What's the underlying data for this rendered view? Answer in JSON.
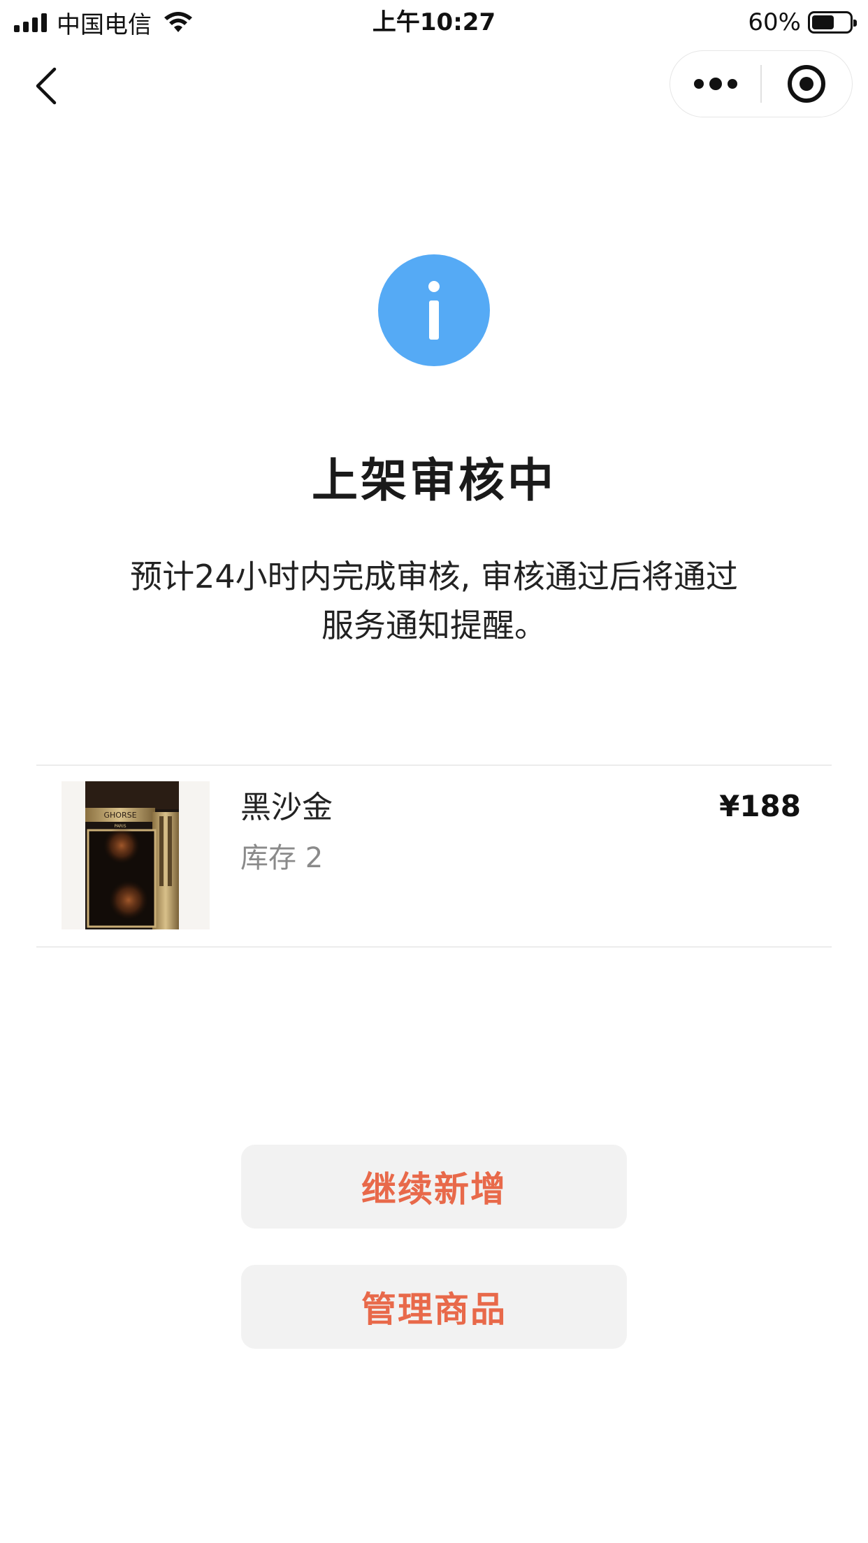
{
  "status_bar": {
    "carrier": "中国电信",
    "time": "上午10:27",
    "battery_percent": "60%",
    "battery_level": 0.6,
    "icons": [
      "signal-icon",
      "wifi-icon",
      "battery-icon"
    ]
  },
  "nav": {
    "icons": [
      "chevron-left-icon",
      "more-dots-icon",
      "target-icon"
    ]
  },
  "result": {
    "icon": "info-icon",
    "icon_color": "#55aaf5",
    "title": "上架审核中",
    "desc_line1": "预计24小时内完成审核, 审核通过后将通过",
    "desc_line2": "服务通知提醒。"
  },
  "product": {
    "name": "黑沙金",
    "stock_label": "库存",
    "stock_value": "2",
    "price": "¥188",
    "image_brand": "GHORSE",
    "image_sub": "PARIS"
  },
  "actions": {
    "continue_label": "继续新增",
    "manage_label": "管理商品",
    "accent": "#e8694a"
  }
}
